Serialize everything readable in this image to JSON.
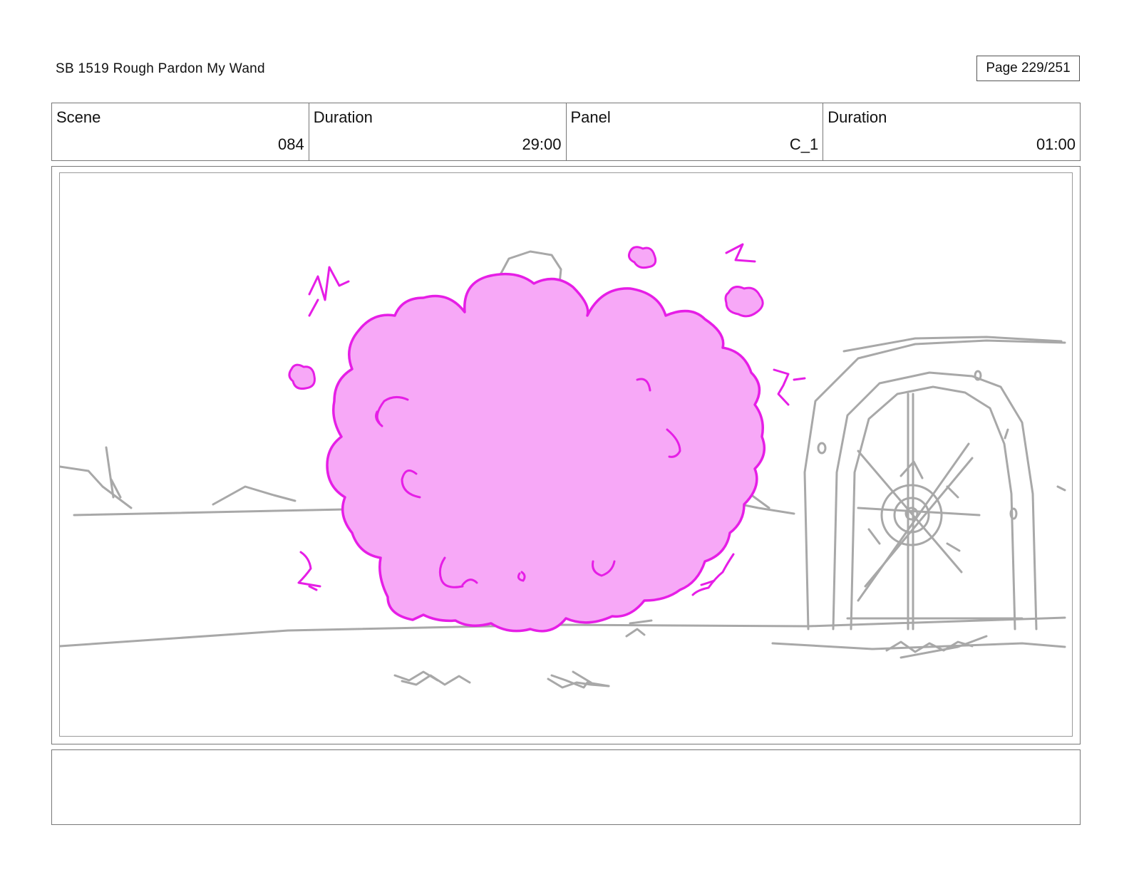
{
  "header": {
    "title": "SB 1519 Rough  Pardon My Wand",
    "page": "Page 229/251"
  },
  "info": {
    "scene_label": "Scene",
    "scene_value": "084",
    "scene_duration_label": "Duration",
    "scene_duration_value": "29:00",
    "panel_label": "Panel",
    "panel_value": "C_1",
    "panel_duration_label": "Duration",
    "panel_duration_value": "01:00"
  },
  "panel": {
    "colors": {
      "pencil": "#a8a8a8",
      "cloud_fill": "#f7a8f7",
      "cloud_stroke": "#e61ee6"
    }
  },
  "notes": {
    "text": ""
  }
}
